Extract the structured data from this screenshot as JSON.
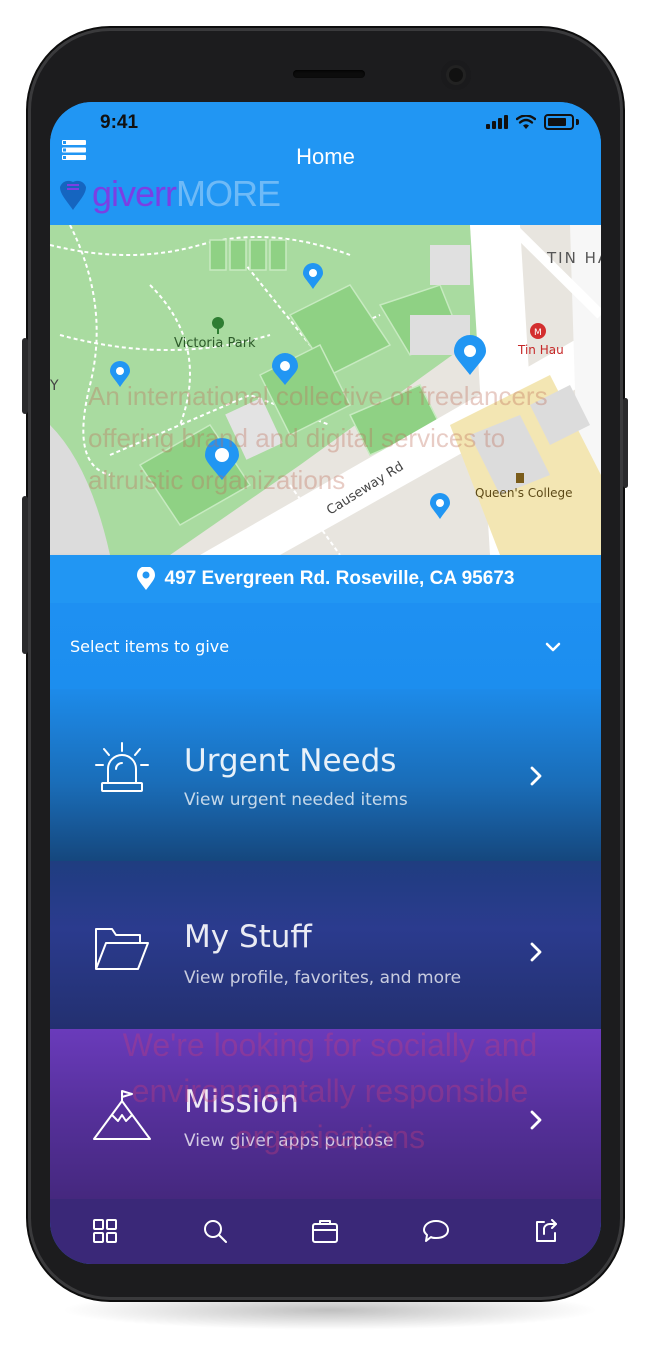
{
  "status_bar": {
    "time": "9:41"
  },
  "header": {
    "title": "Home",
    "logo_text": "giverr",
    "logo_faint_text": "MORE"
  },
  "map": {
    "overlay_text": "An international collective of freelancers offering brand and digital services to altruistic organizations",
    "labels": {
      "park": "Victoria Park",
      "station": "Tin Hau",
      "district": "TIN HA",
      "road": "Causeway Rd",
      "college": "Queen's College",
      "edge": "Y"
    }
  },
  "address": {
    "text": "497 Evergreen Rd. Roseville, CA 95673",
    "icon": "location-pin-icon"
  },
  "select": {
    "label": "Select items to give"
  },
  "menu": [
    {
      "title": "Urgent Needs",
      "subtitle": "View urgent needed items",
      "icon": "siren-icon"
    },
    {
      "title": "My Stuff",
      "subtitle": "View profile, favorites, and more",
      "icon": "folder-icon"
    },
    {
      "title": "Mission",
      "subtitle": "View giver apps purpose",
      "icon": "mountain-flag-icon"
    }
  ],
  "mission_overlay": "We're looking for socially and environmentally responsible organisations",
  "tabbar": [
    "grid-icon",
    "search-icon",
    "wallet-icon",
    "chat-icon",
    "share-icon"
  ],
  "colors": {
    "header_blue": "#2196f3",
    "pin_blue": "#2196f3",
    "logo_purple": "#7b3fe4",
    "tabbar": "#3a2878"
  }
}
